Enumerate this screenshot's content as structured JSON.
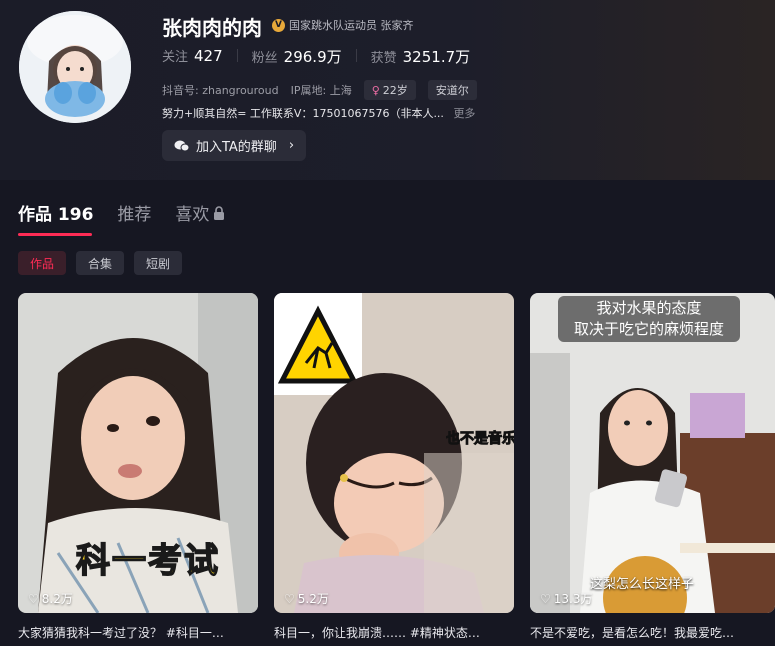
{
  "profile": {
    "name": "张肉肉的肉",
    "verify_badge": "V",
    "verify_text": "国家跳水队运动员 张家齐",
    "stats": [
      {
        "label": "关注",
        "value": "427"
      },
      {
        "label": "粉丝",
        "value": "296.9万"
      },
      {
        "label": "获赞",
        "value": "3251.7万"
      }
    ],
    "douyin_id_label": "抖音号:",
    "douyin_id": "zhangrouroud",
    "ip_label": "IP属地:",
    "ip_value": "上海",
    "age_tag": "22岁",
    "name_tag": "安道尔",
    "bio": "努力+顺其自然= 工作联系V：17501067576（非本人...",
    "bio_more": "更多",
    "group_button": "加入TA的群聊"
  },
  "tabs": [
    {
      "label": "作品 196"
    },
    {
      "label": "推荐"
    },
    {
      "label": "喜欢"
    }
  ],
  "chips": [
    "作品",
    "合集",
    "短剧"
  ],
  "videos": [
    {
      "likes": "8.2万",
      "overlay": "科一考试",
      "caption": "大家猜猜我科一考过了没？ #科目一…"
    },
    {
      "likes": "5.2万",
      "overlay": "也不是音乐",
      "caption": "科目一，你让我崩溃…… #精神状态…"
    },
    {
      "likes": "13.3万",
      "overlay_top1": "我对水果的态度",
      "overlay_top2": "取决于吃它的麻烦程度",
      "overlay": "这梨怎么长这样子",
      "caption": "不是不爱吃，是看怎么吃！我最爱吃…"
    }
  ],
  "colors": {
    "accent": "#fe2c55",
    "background": "#161722"
  }
}
